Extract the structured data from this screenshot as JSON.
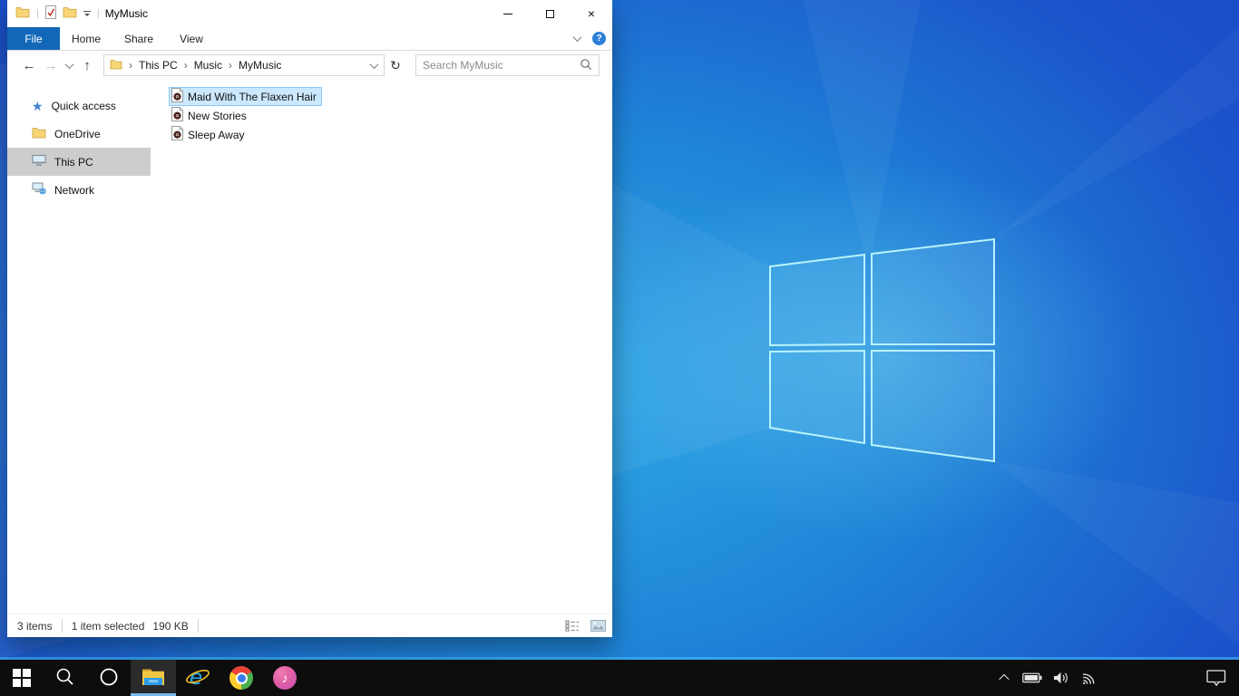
{
  "colors": {
    "accent_blue": "#1267b8",
    "selection_bg": "#cce8ff",
    "selection_border": "#90c8f6",
    "sidebar_selected_bg": "#cdcdcd",
    "taskbar_bg": "#0d0d0d",
    "taskbar_active_underline": "#76b9ed",
    "wallpaper_deep_blue": "#1a49c6",
    "wallpaper_light_blue": "#2fa7e6"
  },
  "explorer": {
    "titlebar": {
      "title": "MyMusic",
      "qat_icons": [
        "folder-icon",
        "properties-icon",
        "folder-icon",
        "customize-quick-access-icon"
      ],
      "window_controls": [
        "minimize",
        "maximize",
        "close"
      ]
    },
    "ribbon": {
      "tabs": [
        {
          "label": "File",
          "active": true
        },
        {
          "label": "Home",
          "active": false
        },
        {
          "label": "Share",
          "active": false
        },
        {
          "label": "View",
          "active": false
        }
      ],
      "help_label": "?"
    },
    "addressbar": {
      "separator": "›",
      "breadcrumb": [
        "This PC",
        "Music",
        "MyMusic"
      ]
    },
    "search": {
      "placeholder": "Search MyMusic"
    },
    "sidebar": {
      "items": [
        {
          "label": "Quick access",
          "icon": "quick-access-star-icon",
          "selected": false
        },
        {
          "label": "OneDrive",
          "icon": "onedrive-folder-icon",
          "selected": false
        },
        {
          "label": "This PC",
          "icon": "this-pc-monitor-icon",
          "selected": true
        },
        {
          "label": "Network",
          "icon": "network-icon",
          "selected": false
        }
      ]
    },
    "files": [
      {
        "name": "Maid With The Flaxen Hair",
        "icon": "audio-file-icon",
        "selected": true
      },
      {
        "name": "New Stories",
        "icon": "audio-file-icon",
        "selected": false
      },
      {
        "name": "Sleep Away",
        "icon": "audio-file-icon",
        "selected": false
      }
    ],
    "statusbar": {
      "item_count": "3 items",
      "selection_count": "1 item selected",
      "selection_size": "190 KB",
      "view_toggles": [
        "details-view",
        "large-icons-view"
      ]
    }
  },
  "taskbar": {
    "buttons": [
      "start",
      "search",
      "cortana",
      "file-explorer",
      "internet-explorer",
      "chrome",
      "itunes"
    ],
    "active_button": "file-explorer",
    "tray_icons": [
      "hidden-icons-chevron",
      "battery",
      "volume",
      "wifi",
      "action-center"
    ]
  },
  "glyphs": {
    "back": "←",
    "forward": "→",
    "up": "↑",
    "refresh": "↻",
    "close": "×",
    "pipe": "|",
    "quick_access_star": "★",
    "itunes_note": "♪"
  }
}
